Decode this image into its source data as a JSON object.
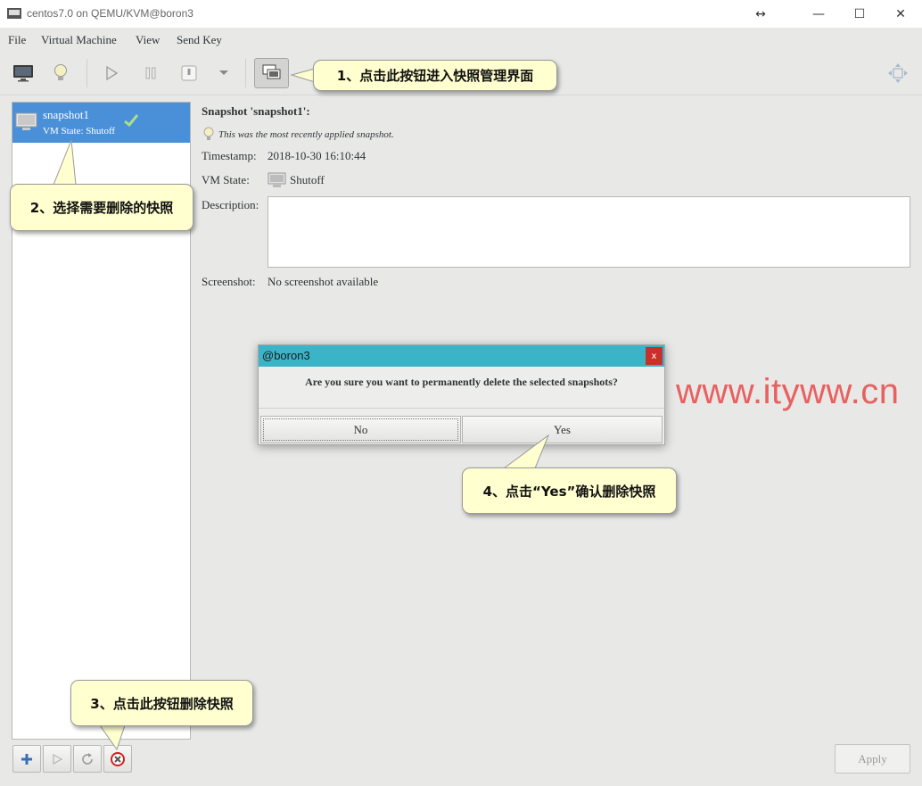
{
  "window": {
    "title": "centos7.0 on QEMU/KVM@boron3",
    "move_glyph": "↔",
    "minimize_glyph": "—",
    "maximize_glyph": "☐",
    "close_glyph": "✕"
  },
  "menu": {
    "file": "File",
    "virtual_machine": "Virtual Machine",
    "view": "View",
    "send_key": "Send Key"
  },
  "snapshots": [
    {
      "name": "snapshot1",
      "state": "VM State: Shutoff"
    }
  ],
  "detail": {
    "heading": "Snapshot 'snapshot1':",
    "note": "This was the most recently applied snapshot.",
    "timestamp_label": "Timestamp:",
    "timestamp_value": "2018-10-30 16:10:44",
    "vmstate_label": "VM State:",
    "vmstate_value": "Shutoff",
    "description_label": "Description:",
    "description_value": "",
    "screenshot_label": "Screenshot:",
    "screenshot_value": "No screenshot available"
  },
  "bottom": {
    "apply_label": "Apply"
  },
  "dialog": {
    "title": "@boron3",
    "close_glyph": "x",
    "message": "Are you sure you want to permanently delete the selected snapshots?",
    "no_label": "No",
    "yes_label": "Yes"
  },
  "callouts": {
    "c1": "1、点击此按钮进入快照管理界面",
    "c2": "2、选择需要删除的快照",
    "c3": "3、点击此按钮删除快照",
    "c4": "4、点击“Yes”确认删除快照"
  },
  "watermark": "www.ityww.cn",
  "colors": {
    "selection": "#4a90d9",
    "dialog_titlebar": "#3cb4c8",
    "callout_bg": "#ffffcf",
    "watermark": "#e86060"
  }
}
